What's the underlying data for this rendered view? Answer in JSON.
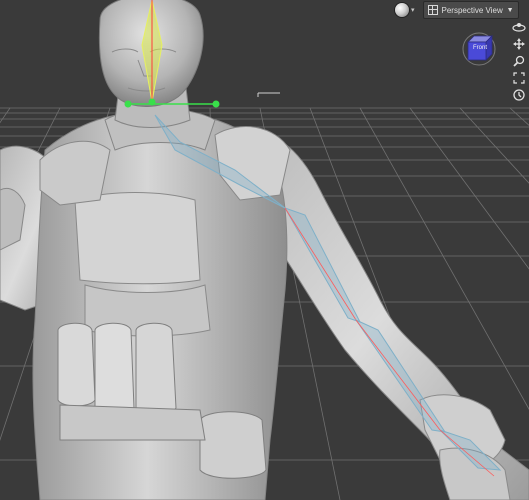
{
  "viewport": {
    "camera_label": "Perspective View",
    "nav_cube_label": "Front"
  },
  "toolbar": {
    "render_icon": "render-preview-sphere-icon",
    "view_icon": "viewport-layout-icon",
    "dropdown_icon": "chevron-down-icon"
  },
  "nav_tools": [
    "orbit-icon",
    "pan-icon",
    "zoom-icon",
    "frame-icon",
    "reset-camera-icon"
  ],
  "colors": {
    "background": "#3a3a3a",
    "grid": "#6f6f6f",
    "figure": "#c4c4c4",
    "bone": "#7fb0c8",
    "selected_bone": "#d9e84a",
    "joint_handle": "#39e04a",
    "nav_cube_face": "#4a4ad8"
  }
}
